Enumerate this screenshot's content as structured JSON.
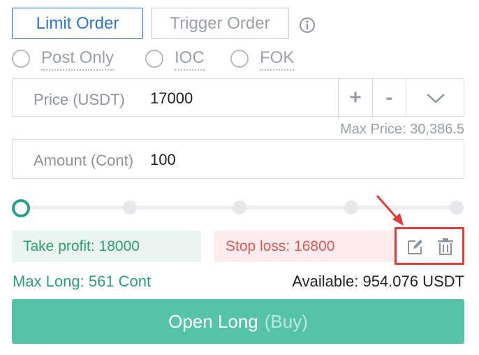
{
  "order_tabs": [
    {
      "label": "Limit Order",
      "active": true
    },
    {
      "label": "Trigger Order",
      "active": false
    }
  ],
  "icons": {
    "info": "info-icon",
    "edit": "edit-icon",
    "delete": "trash-icon",
    "annotation": "red-arrow-icon"
  },
  "order_options": [
    {
      "label": "Post Only",
      "checked": false
    },
    {
      "label": "IOC",
      "checked": false
    },
    {
      "label": "FOK",
      "checked": false
    }
  ],
  "price": {
    "label": "Price (USDT)",
    "value": "17000",
    "increment": "+",
    "decrement": "-"
  },
  "max_price": "Max Price: 30,386.5",
  "amount": {
    "label": "Amount (Cont)",
    "value": "100"
  },
  "slider": {
    "value": 0,
    "stops": [
      0,
      25,
      50,
      75,
      100
    ]
  },
  "take_profit": "Take profit: 18000",
  "stop_loss": "Stop loss: 16800",
  "max_long": "Max Long: 561 Cont",
  "available": "Available: 954.076 USDT",
  "open_button": {
    "label": "Open Long",
    "sub": "(Buy)"
  },
  "colors": {
    "accent_blue": "#2f74d0",
    "long_green": "#56c3a8",
    "profit_green": "#2e9e73",
    "loss_red": "#e05858",
    "highlight_red": "#e33b3b"
  }
}
